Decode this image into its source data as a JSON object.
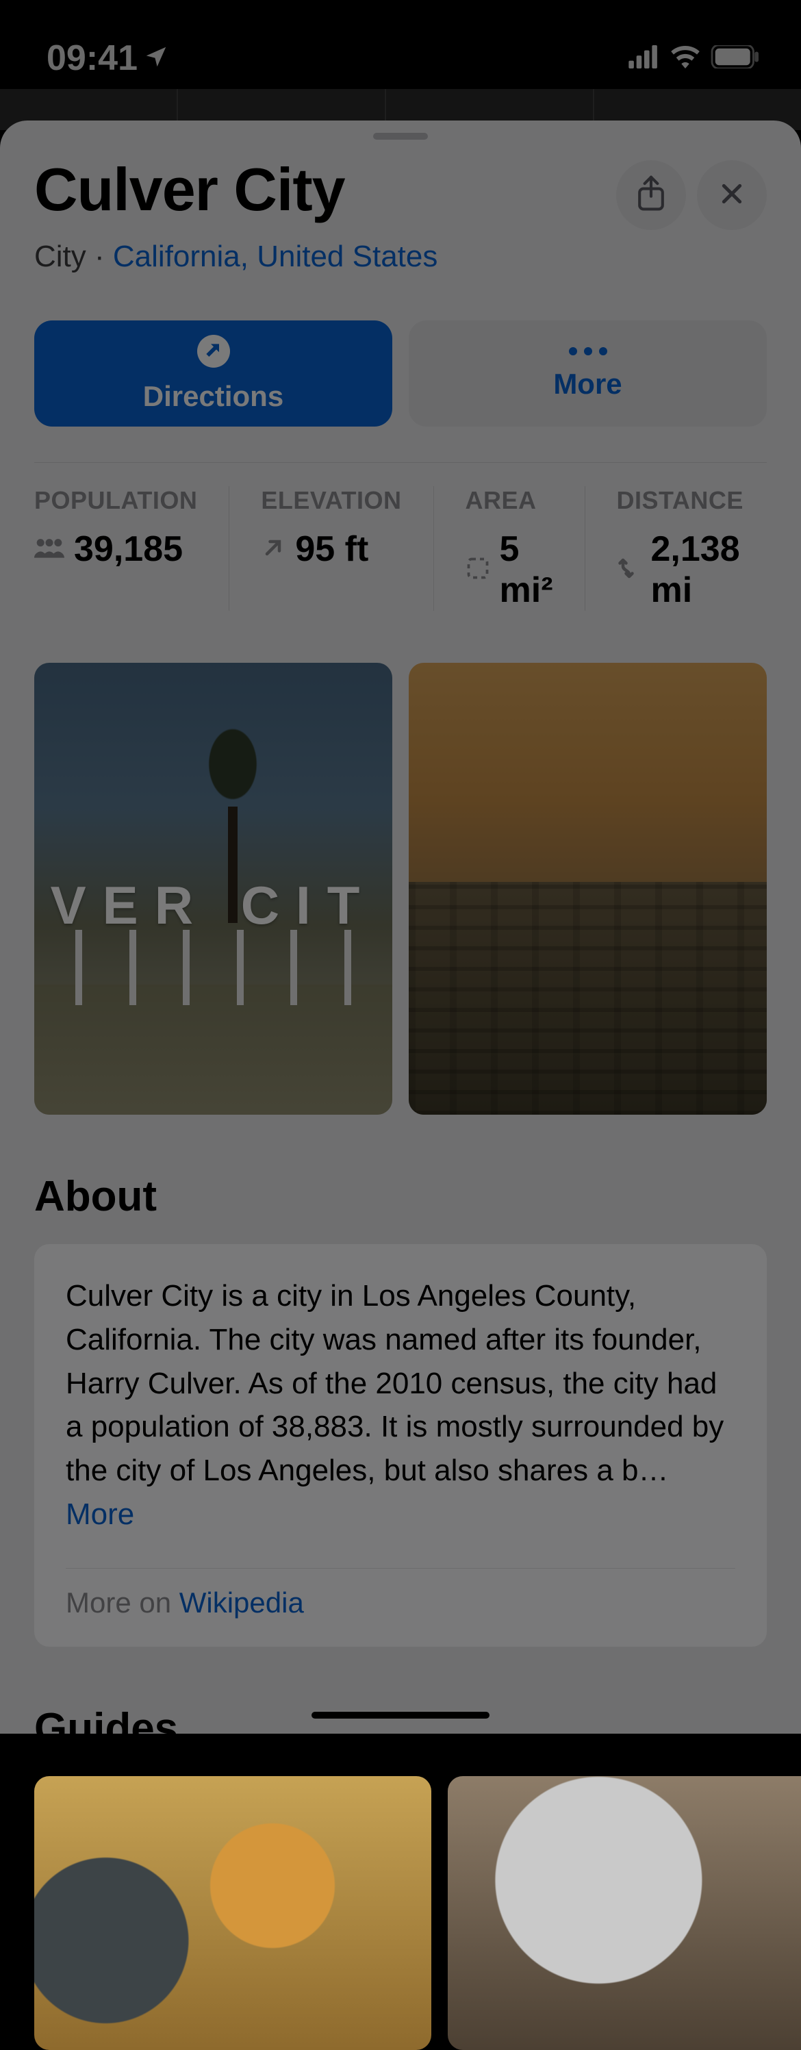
{
  "status": {
    "time": "09:41"
  },
  "header": {
    "title": "Culver City",
    "type": "City",
    "location": "California, United States"
  },
  "actions": {
    "primary": "Directions",
    "secondary": "More"
  },
  "stats": [
    {
      "label": "POPULATION",
      "value": "39,185",
      "icon": "people"
    },
    {
      "label": "ELEVATION",
      "value": "95 ft",
      "icon": "arrow-up-right"
    },
    {
      "label": "AREA",
      "value": "5 mi²",
      "icon": "crop"
    },
    {
      "label": "DISTANCE",
      "value": "2,138 mi",
      "icon": "route"
    }
  ],
  "photo1_sign": "VER  CIT",
  "about": {
    "title": "About",
    "text": "Culver City is a city in Los Angeles County, California. The city was named after its founder, Harry Culver. As of the 2010 census, the city had a population of 38,883. It is mostly surrounded by the city of Los Angeles, but also shares a b…",
    "more_link": "More",
    "more_on": "More on ",
    "more_on_link": "Wikipedia"
  },
  "guides": {
    "title": "Guides"
  }
}
